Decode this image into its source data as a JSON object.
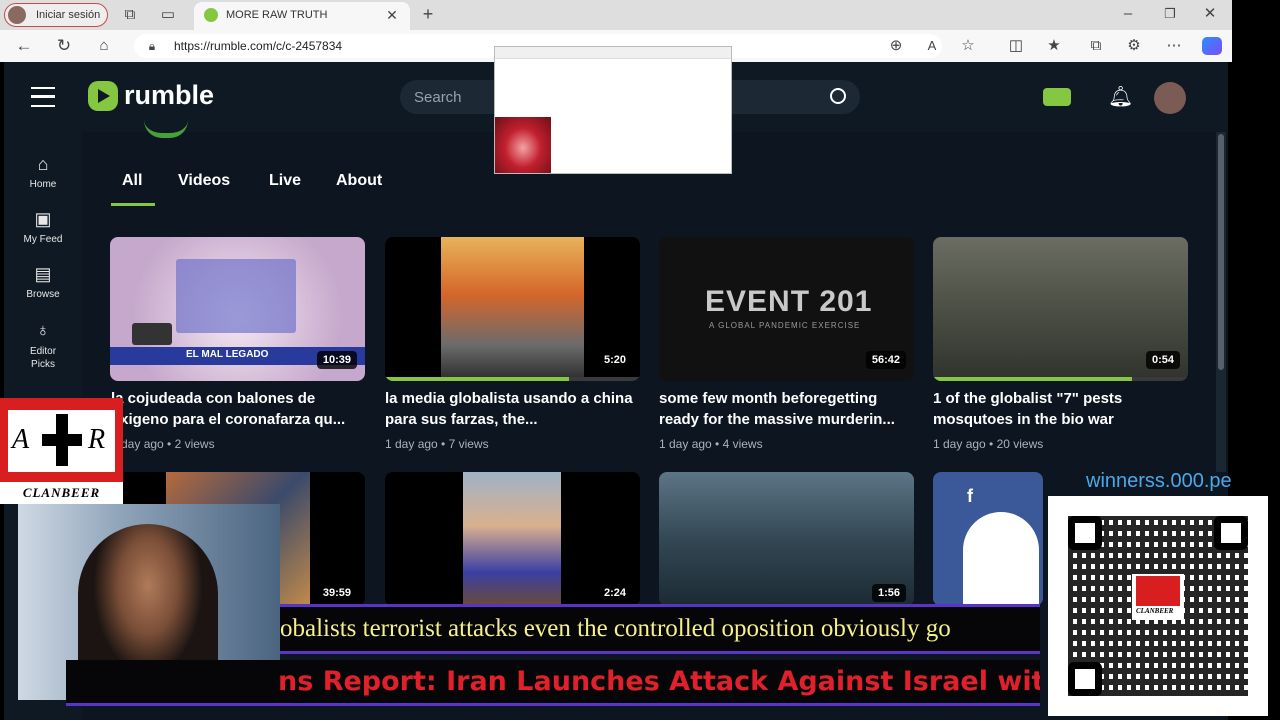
{
  "browser": {
    "profile_label": "Iniciar sesión",
    "tab_title": "MORE RAW TRUTH",
    "url": "https://rumble.com/c/c-2457834"
  },
  "header": {
    "logo_text": "rumble",
    "search_placeholder": "Search"
  },
  "sidebar": {
    "items": [
      {
        "label": "Home",
        "icon": "home-icon"
      },
      {
        "label": "My Feed",
        "icon": "feed-icon"
      },
      {
        "label": "Browse",
        "icon": "browse-icon"
      },
      {
        "label": "Editor Picks",
        "icon": "award-icon"
      }
    ]
  },
  "tabs": [
    "All",
    "Videos",
    "Live",
    "About"
  ],
  "videos_row1": [
    {
      "title": "la cojudeada con balones de oxigeno para el coronafarza qu...",
      "meta": "1 day ago • 2 views",
      "duration": "10:39",
      "thumb_caption": "EL MAL LEGADO",
      "progress": 0
    },
    {
      "title": "la media globalista usando a china para sus farzas, the...",
      "meta": "1 day ago • 7 views",
      "duration": "5:20",
      "progress": 0.72
    },
    {
      "title": "some few month beforegetting ready for the massive murderin...",
      "meta": "1 day ago • 4 views",
      "duration": "56:42",
      "thumb_caption": "EVENT 201",
      "thumb_sub": "A GLOBAL PANDEMIC EXERCISE",
      "progress": 0
    },
    {
      "title": "1 of the globalist \"7\" pests mosqutoes in the bio war",
      "meta": "1 day ago • 20 views",
      "duration": "0:54",
      "progress": 0.78
    }
  ],
  "videos_row2": [
    {
      "duration": "39:59"
    },
    {
      "duration": "2:24"
    },
    {
      "duration": "1:56"
    }
  ],
  "overlay": {
    "badge_text": "CLANBEER",
    "badge_letters": [
      "A",
      "R"
    ],
    "site": "winnerss.000.pe",
    "qr_caption": "CLANBEER",
    "ticker1": "obalists terrorist attacks even the controlled oposition obviously go",
    "ticker2": "ns Report: Iran Launches Attack Against Israel with"
  },
  "colors": {
    "rumble_green": "#85c742",
    "page_bg": "#0d1620",
    "ticker1_text": "#f5f08a",
    "ticker2_text": "#e0202a",
    "ticker_border": "#5a33c9"
  }
}
